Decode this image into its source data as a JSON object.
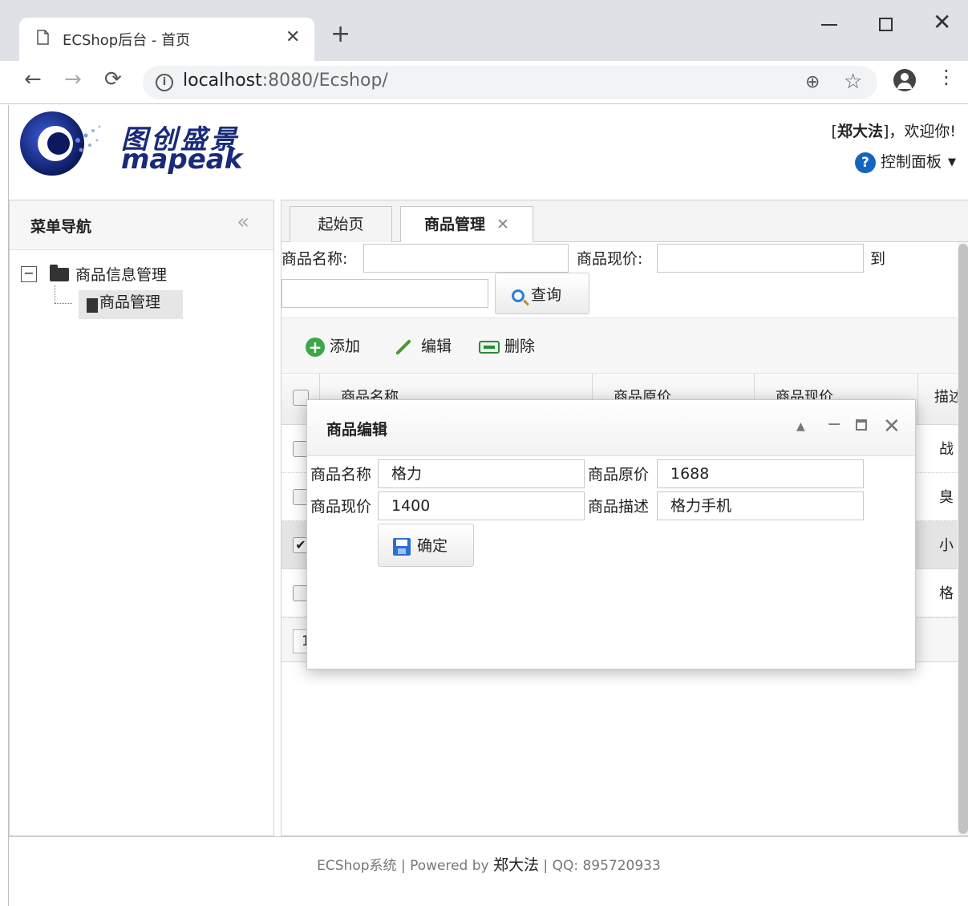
{
  "browser": {
    "tab_title": "ECShop后台 - 首页",
    "url_host": "localhost",
    "url_rest": ":8080/Ecshop/"
  },
  "header": {
    "logo_cn": "图创盛景",
    "logo_en": "mapeak",
    "user": "郑大法",
    "welcome_suffix": "，欢迎你!",
    "control_panel": "控制面板"
  },
  "west": {
    "title": "菜单导航",
    "tree": {
      "parent": "商品信息管理",
      "child": "商品管理"
    }
  },
  "tabs": [
    {
      "label": "起始页"
    },
    {
      "label": "商品管理"
    }
  ],
  "search": {
    "name_label": "商品名称:",
    "price_label": "商品现价:",
    "to_label": "到",
    "query_button": "查询"
  },
  "toolbar": {
    "add": "添加",
    "edit": "编辑",
    "delete": "删除"
  },
  "grid": {
    "columns": [
      "商品名称",
      "商品原价",
      "商品现价",
      "描述"
    ],
    "rows": [
      {
        "desc": "战",
        "checked": false
      },
      {
        "desc": "臭",
        "checked": false
      },
      {
        "desc": "小",
        "checked": true
      },
      {
        "desc": "格",
        "checked": false
      }
    ],
    "page": "1"
  },
  "dialog": {
    "title": "商品编辑",
    "labels": {
      "name": "商品名称",
      "orig_price": "商品原价",
      "cur_price": "商品现价",
      "desc": "商品描述"
    },
    "values": {
      "name": "格力",
      "orig_price": "1688",
      "cur_price": "1400",
      "desc": "格力手机"
    },
    "confirm": "确定"
  },
  "footer": {
    "left": "ECShop系统 | Powered by ",
    "name": "郑大法",
    "right": " | QQ:  895720933"
  },
  "colors": {
    "accent": "#1565c0",
    "brand": "#1a2a7a"
  }
}
